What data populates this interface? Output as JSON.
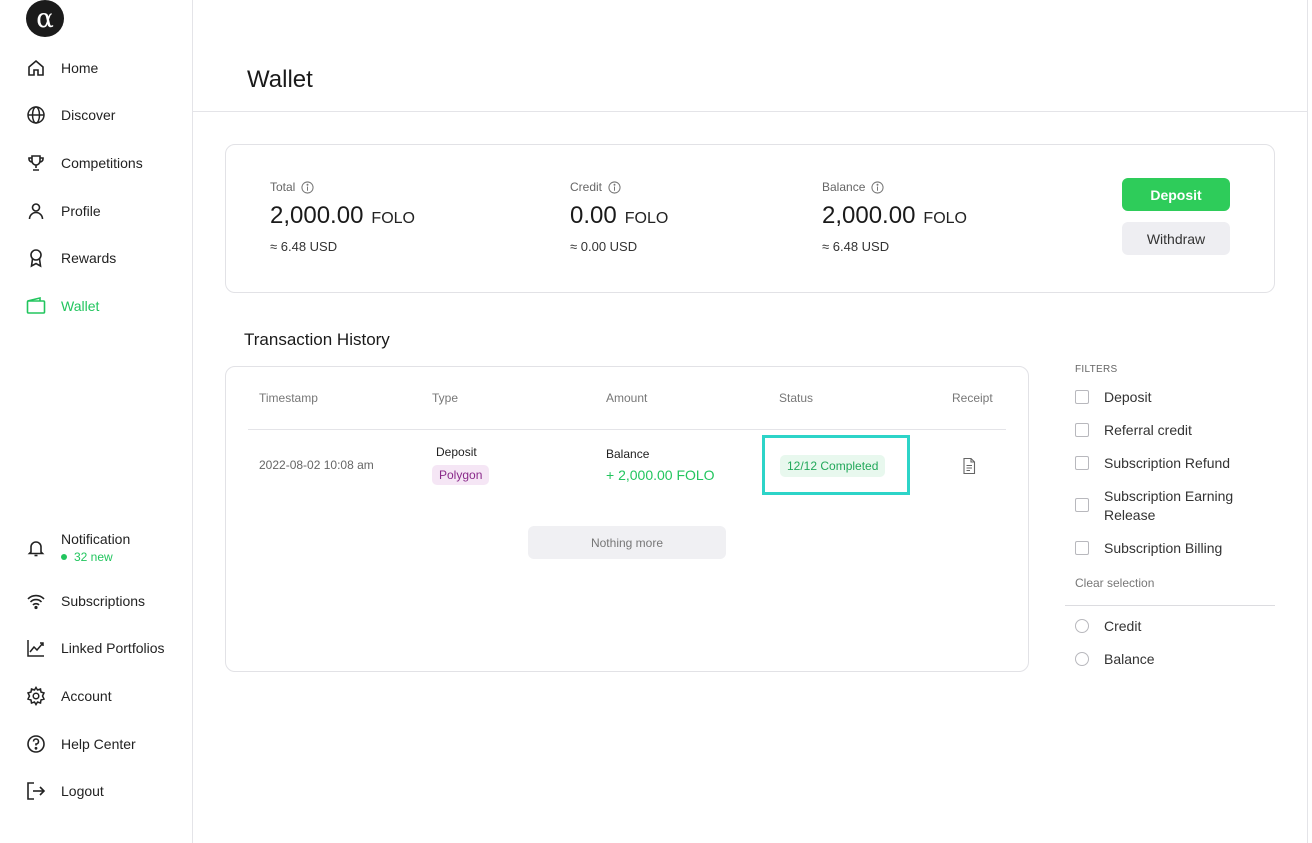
{
  "sidebar": {
    "logo": "α",
    "items": [
      {
        "label": "Home",
        "icon": "home-icon"
      },
      {
        "label": "Discover",
        "icon": "globe-icon"
      },
      {
        "label": "Competitions",
        "icon": "trophy-icon"
      },
      {
        "label": "Profile",
        "icon": "user-icon"
      },
      {
        "label": "Rewards",
        "icon": "award-icon"
      },
      {
        "label": "Wallet",
        "icon": "wallet-icon",
        "active": true
      }
    ],
    "bottom_items": [
      {
        "label": "Notification",
        "icon": "bell-icon",
        "sub": "32 new"
      },
      {
        "label": "Subscriptions",
        "icon": "wifi-icon"
      },
      {
        "label": "Linked Portfolios",
        "icon": "chart-line-icon"
      },
      {
        "label": "Account",
        "icon": "gear-icon"
      },
      {
        "label": "Help Center",
        "icon": "help-circle-icon"
      },
      {
        "label": "Logout",
        "icon": "logout-icon"
      }
    ],
    "active_color": "#22c55e"
  },
  "header": {
    "title": "Wallet"
  },
  "summary": {
    "total": {
      "label": "Total",
      "amount": "2,000.00",
      "unit": "FOLO",
      "usd": "≈ 6.48 USD"
    },
    "credit": {
      "label": "Credit",
      "amount": "0.00",
      "unit": "FOLO",
      "usd": "≈ 0.00 USD"
    },
    "balance": {
      "label": "Balance",
      "amount": "2,000.00",
      "unit": "FOLO",
      "usd": "≈ 6.48 USD"
    },
    "deposit_label": "Deposit",
    "withdraw_label": "Withdraw",
    "deposit_color": "#2ecc5a"
  },
  "history": {
    "title": "Transaction History",
    "columns": [
      "Timestamp",
      "Type",
      "Amount",
      "Status",
      "Receipt"
    ],
    "rows": [
      {
        "timestamp": "2022-08-02 10:08 am",
        "type": "Deposit",
        "chain": "Polygon",
        "amount_label": "Balance",
        "amount": "+ 2,000.00 FOLO",
        "status": "12/12 Completed",
        "receipt_icon": "document-icon"
      }
    ],
    "nothing_more": "Nothing more"
  },
  "filters": {
    "title": "FILTERS",
    "checkboxes": [
      "Deposit",
      "Referral credit",
      "Subscription Refund",
      "Subscription Earning Release",
      "Subscription Billing"
    ],
    "clear_label": "Clear selection",
    "radios": [
      "Credit",
      "Balance"
    ]
  }
}
